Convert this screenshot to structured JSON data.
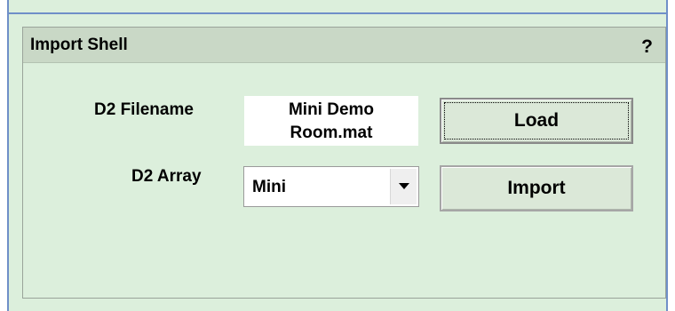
{
  "panel": {
    "title": "Import Shell",
    "help_label": "?"
  },
  "filename": {
    "label": "D2 Filename",
    "value_line1": "Mini Demo",
    "value_line2": "Room.mat"
  },
  "array": {
    "label": "D2 Array",
    "selected": "Mini"
  },
  "buttons": {
    "load": "Load",
    "import": "Import"
  },
  "colors": {
    "panel_bg": "#dcefdc",
    "header_bg": "#c9d8c6",
    "frame_border": "#6f8fc8"
  }
}
